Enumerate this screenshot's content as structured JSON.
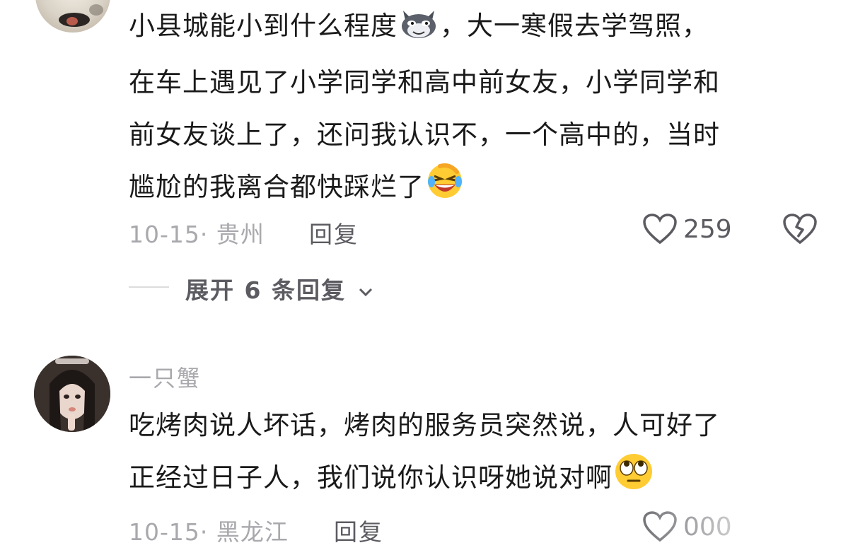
{
  "comment1": {
    "lines": [
      "小县城能小到什么程度",
      "，大一寒假去学驾照，",
      "在车上遇见了小学同学和高中前女友，小学同学和",
      "前女友谈上了，还问我认识不，一个高中的，当时",
      "尴尬的我离合都快踩烂了"
    ],
    "emoji_1": "wolf-emoji",
    "emoji_2": "rolling-laughing-emoji",
    "date_location": "10-15· 贵州",
    "reply_label": "回复",
    "likes": "259"
  },
  "expand": {
    "label": "展开 6 条回复",
    "icon": "chevron-down-icon"
  },
  "comment2": {
    "username": "一只蟹",
    "lines": [
      "吃烤肉说人坏话，烤肉的服务员突然说，人可好了",
      "正经过日子人，我们说你认识呀她说对啊"
    ],
    "emoji": "rolling-eyes-emoji",
    "date_location": "10-15· 黑龙江",
    "reply_label": "回复",
    "likes": "000"
  },
  "colors": {
    "text": "#1a1a1a",
    "meta": "#a8a8ad",
    "action": "#5b5b61",
    "background": "#ffffff"
  }
}
